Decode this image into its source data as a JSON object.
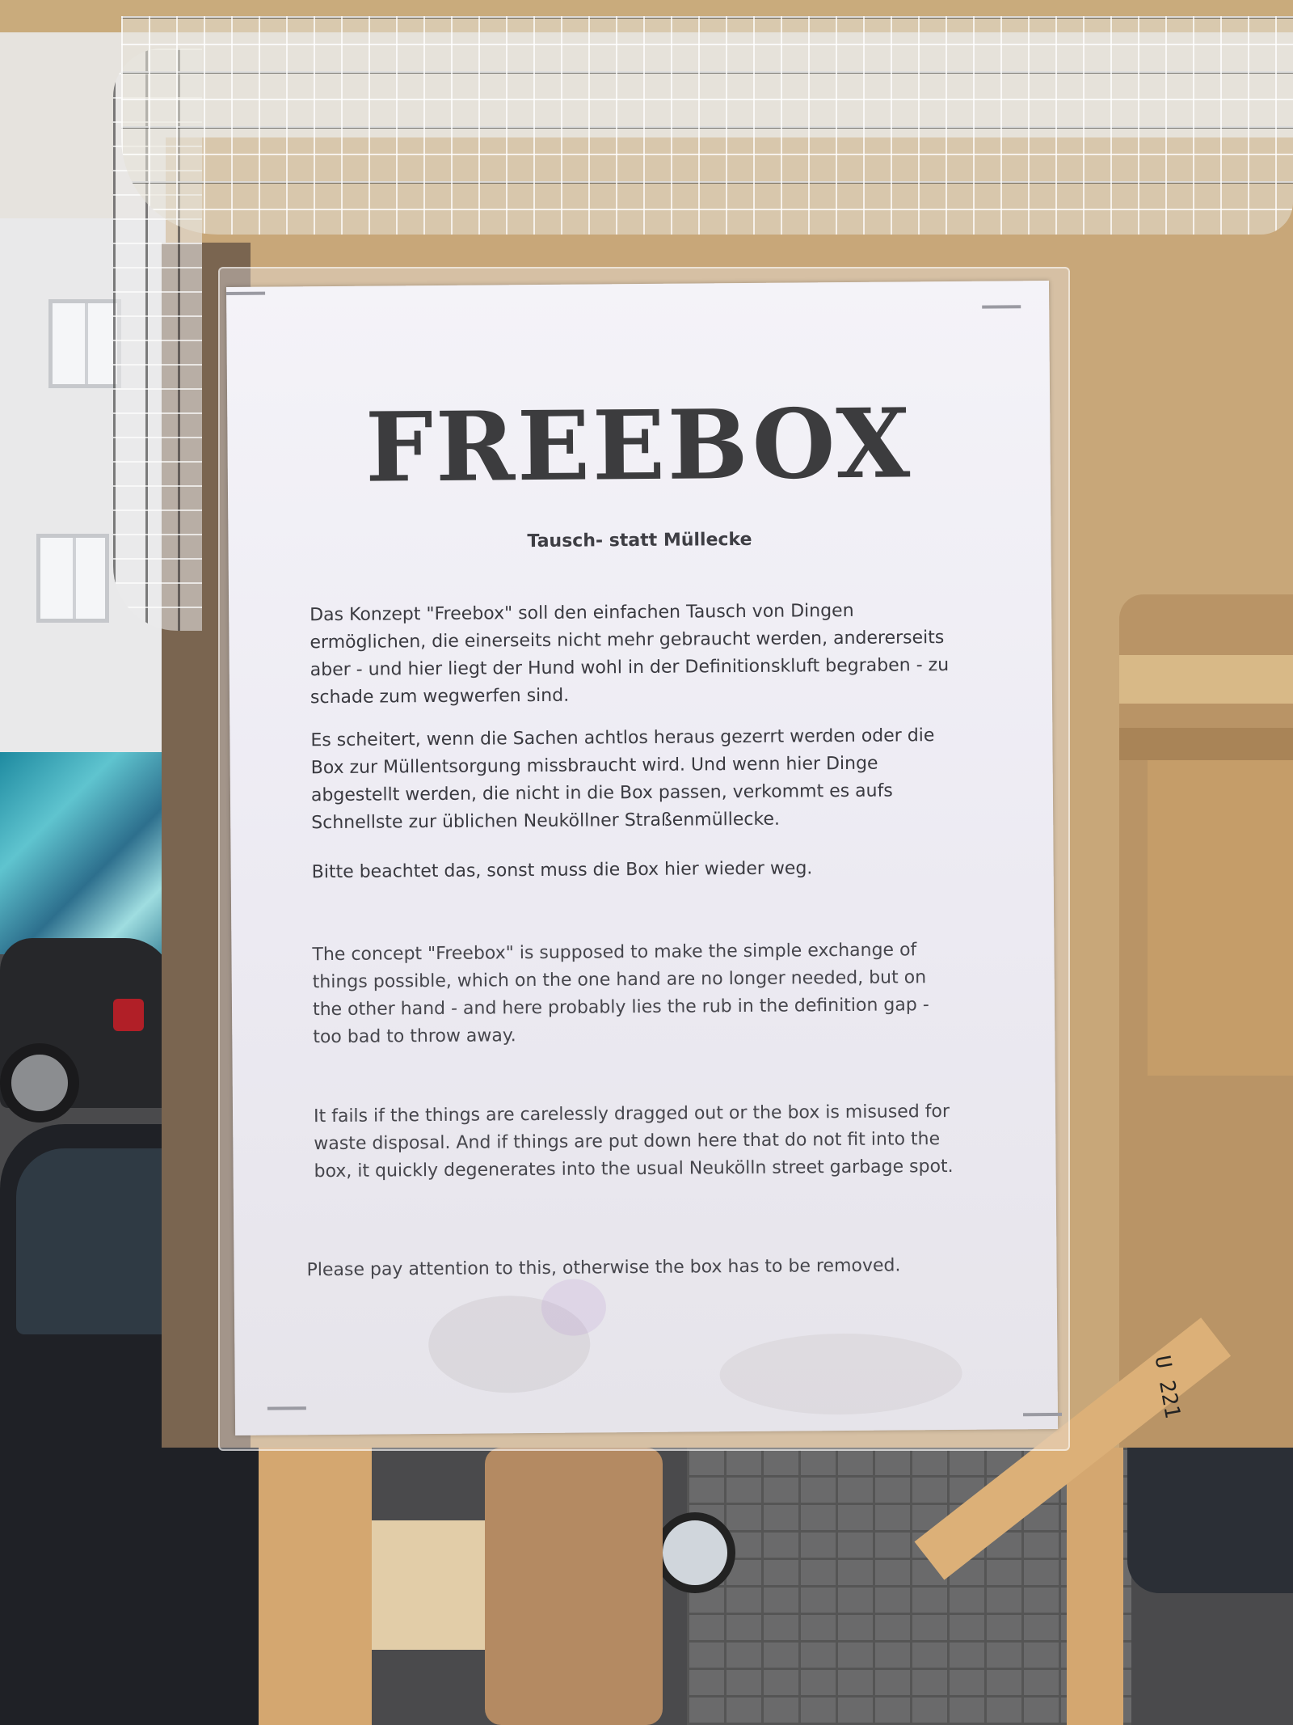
{
  "notice": {
    "title": "FREEBOX",
    "subtitle": "Tausch- statt Müllecke",
    "german": [
      "Das Konzept \"Freebox\" soll den einfachen Tausch von Dingen ermöglichen, die einerseits nicht mehr gebraucht werden, andererseits aber - und hier liegt der Hund wohl in der Definitionskluft begraben - zu schade zum wegwerfen sind.",
      "Es scheitert, wenn die Sachen achtlos heraus gezerrt werden  oder die Box zur Müllentsorgung missbraucht wird. Und wenn hier Dinge abgestellt werden, die nicht in die Box passen, verkommt es aufs Schnellste zur üblichen Neuköllner Straßenmüllecke.",
      "Bitte beachtet das, sonst muss die Box hier wieder weg."
    ],
    "english": [
      "The concept \"Freebox\" is supposed to make the simple exchange of things possible, which on the one hand are no longer needed, but on the other hand - and here probably lies the rub in the definition gap - too bad to throw away.",
      "It fails if the things are carelessly dragged out or the box is misused for waste disposal. And if things are put down here that do not fit into the box, it quickly degenerates into the usual Neukölln street garbage spot.",
      "Please pay attention to this, otherwise the box has to be removed."
    ]
  },
  "scene": {
    "license_plate_text": "U 221"
  }
}
